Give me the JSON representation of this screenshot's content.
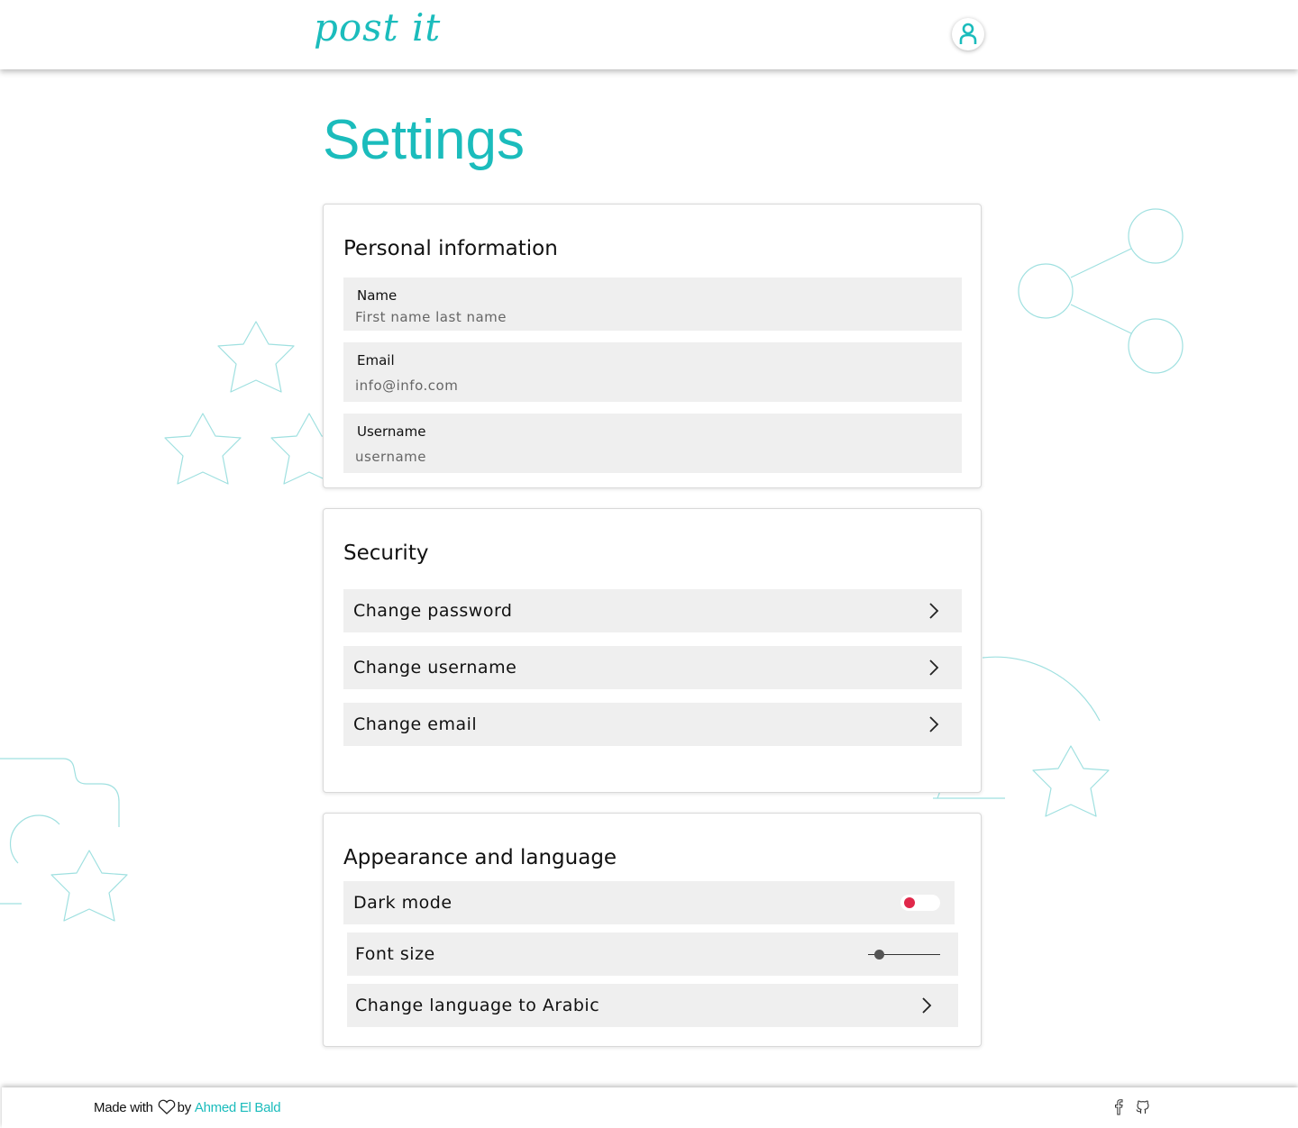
{
  "header": {
    "logo_text": "post it",
    "profile_icon": "user-icon"
  },
  "page": {
    "title": "Settings"
  },
  "personal_info": {
    "title": "Personal information",
    "fields": [
      {
        "label": "Name",
        "placeholder": "First name last name"
      },
      {
        "label": "Email",
        "placeholder": "info@info.com"
      },
      {
        "label": "Username",
        "placeholder": "username"
      }
    ]
  },
  "security": {
    "title": "Security",
    "items": [
      {
        "label": "Change password"
      },
      {
        "label": "Change username"
      },
      {
        "label": "Change email"
      }
    ]
  },
  "appearance": {
    "title": "Appearance and language",
    "dark_mode_label": "Dark mode",
    "dark_mode_on": false,
    "font_size_label": "Font size",
    "font_size_level": 0.1,
    "language_label": "Change language to Arabic"
  },
  "footer": {
    "made_with": "Made with",
    "by": "by",
    "author": "Ahmed El Bald",
    "social_icons": [
      "facebook-icon",
      "github-icon"
    ]
  },
  "colors": {
    "accent": "#1bbcbc",
    "toggle_knob": "#e0284a",
    "field_bg": "#efefef"
  }
}
